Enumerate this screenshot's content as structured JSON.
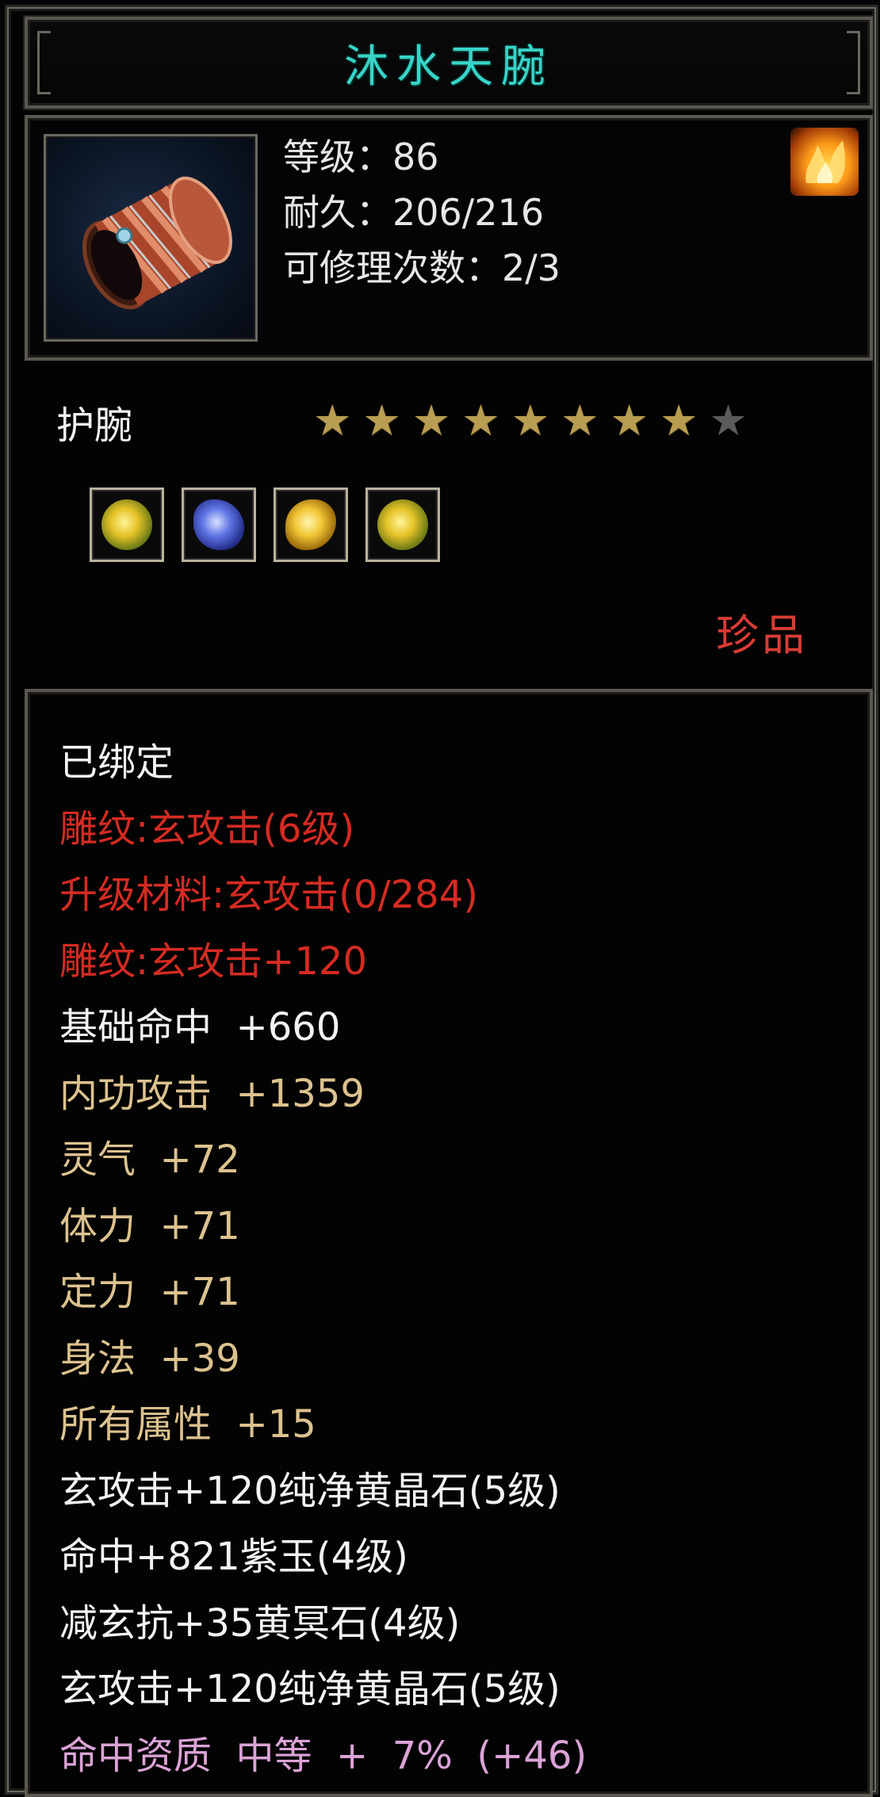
{
  "item": {
    "name": "沐水天腕",
    "level_line": "等级：86",
    "durability_line": "耐久：206/216",
    "repair_line": "可修理次数：2/3",
    "type": "护腕",
    "rarity": "珍品",
    "stars": {
      "filled": 8,
      "total": 9
    },
    "gems": [
      {
        "name": "yellow-green-crystal-gem-icon"
      },
      {
        "name": "blue-jade-gem-icon"
      },
      {
        "name": "yellow-crystal-gem-icon"
      },
      {
        "name": "yellow-green-crystal-gem-icon"
      }
    ]
  },
  "attributes": [
    {
      "text": "已绑定",
      "color": "white"
    },
    {
      "text": "雕纹:玄攻击(6级)",
      "color": "red"
    },
    {
      "text": "升级材料:玄攻击(0/284)",
      "color": "red"
    },
    {
      "text": "雕纹:玄攻击+120",
      "color": "red"
    },
    {
      "text": "基础命中  +660",
      "color": "white"
    },
    {
      "text": "内功攻击  +1359",
      "color": "tan"
    },
    {
      "text": "灵气  +72",
      "color": "tan"
    },
    {
      "text": "体力  +71",
      "color": "tan"
    },
    {
      "text": "定力  +71",
      "color": "tan"
    },
    {
      "text": "身法  +39",
      "color": "tan"
    },
    {
      "text": "所有属性  +15",
      "color": "tan"
    },
    {
      "text": "玄攻击+120纯净黄晶石(5级)",
      "color": "white"
    },
    {
      "text": "命中+821紫玉(4级)",
      "color": "white"
    },
    {
      "text": "减玄抗+35黄冥石(4级)",
      "color": "white"
    },
    {
      "text": "玄攻击+120纯净黄晶石(5级)",
      "color": "white"
    },
    {
      "text": "命中资质  中等  +  7%  (+46)",
      "color": "pink"
    }
  ],
  "colors": {
    "title": "#38d4c8",
    "white": "#f3f3f3",
    "red": "#d42b22",
    "tan": "#dcc28e",
    "pink": "#dba3d6",
    "rarity": "#d93b35",
    "star_filled": "#b89d52",
    "star_empty": "#5b5b5b"
  }
}
